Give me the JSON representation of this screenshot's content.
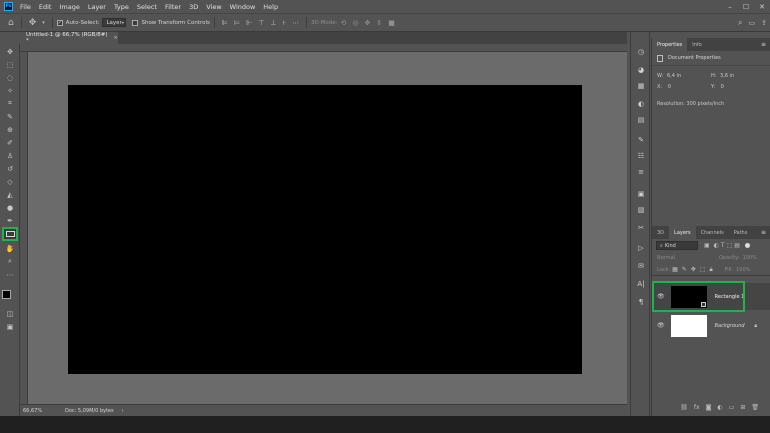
{
  "menubar": {
    "logo": "Ps",
    "items": [
      "File",
      "Edit",
      "Image",
      "Layer",
      "Type",
      "Select",
      "Filter",
      "3D",
      "View",
      "Window",
      "Help"
    ],
    "window_controls": [
      "–",
      "☐",
      "✕"
    ]
  },
  "options_bar": {
    "auto_select_label": "Auto-Select:",
    "auto_select_value": "Layer",
    "show_transform_label": "Show Transform Controls",
    "mode_3d_label": "3D Mode:"
  },
  "document_tab": {
    "title": "Untitled-1 @ 66,7% (RGB/8#) *",
    "close": "×"
  },
  "status": {
    "zoom": "66,67%",
    "doc_info": "Doc: 5,09M/0 bytes"
  },
  "properties_panel": {
    "tabs": [
      "Properties",
      "Info"
    ],
    "section": "Document Properties",
    "w_label": "W:",
    "w_value": "6,4 in",
    "h_label": "H:",
    "h_value": "3,6 in",
    "x_label": "X:",
    "x_value": "0",
    "y_label": "Y:",
    "y_value": "0",
    "resolution": "Resolution: 300 pixels/inch"
  },
  "layers_panel": {
    "tabs": [
      "3D",
      "Layers",
      "Channels",
      "Paths"
    ],
    "filter_kind": "Kind",
    "blend_mode": "Normal",
    "opacity_label": "Opacity:",
    "opacity_value": "100%",
    "lock_label": "Lock:",
    "fill_label": "Fill:",
    "fill_value": "100%",
    "layers": [
      {
        "name": "Rectangle 1",
        "selected": true
      },
      {
        "name": "Background",
        "selected": false
      }
    ]
  },
  "colors": {
    "accent_highlight": "#22b14c",
    "canvas": "#000000"
  }
}
